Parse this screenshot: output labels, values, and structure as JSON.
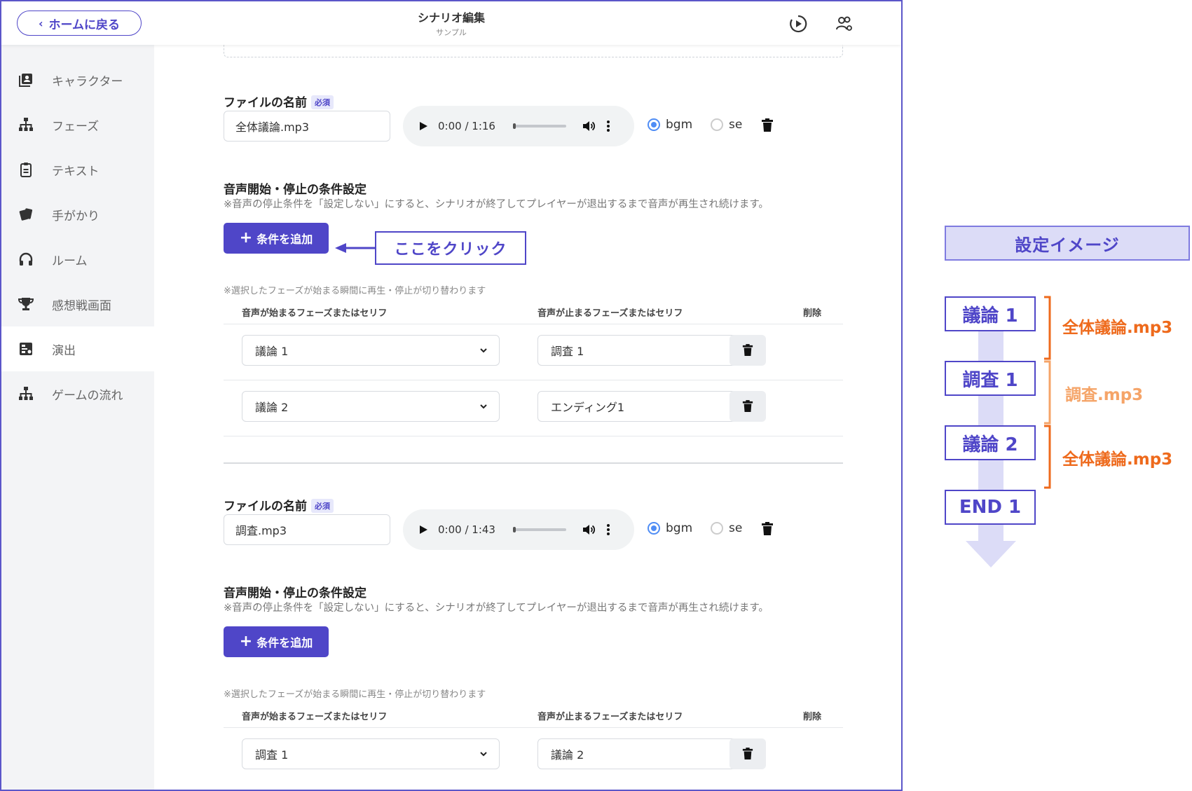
{
  "header": {
    "back_label": "ホームに戻る",
    "title": "シナリオ編集",
    "subtitle": "サンプル"
  },
  "sidebar": {
    "items": [
      {
        "label": "キャラクター",
        "icon": "character-book-icon"
      },
      {
        "label": "フェーズ",
        "icon": "hierarchy-icon"
      },
      {
        "label": "テキスト",
        "icon": "clipboard-icon"
      },
      {
        "label": "手がかり",
        "icon": "cards-icon"
      },
      {
        "label": "ルーム",
        "icon": "headphones-icon"
      },
      {
        "label": "感想戦画面",
        "icon": "trophy-icon"
      },
      {
        "label": "演出",
        "icon": "media-board-icon",
        "active": true
      },
      {
        "label": "ゲームの流れ",
        "icon": "hierarchy-icon"
      }
    ]
  },
  "files": [
    {
      "name_label": "ファイルの名前",
      "required_badge": "必須",
      "filename": "全体議論.mp3",
      "player_time": "0:00 / 1:16",
      "type_options": [
        "bgm",
        "se"
      ],
      "selected_type": "bgm",
      "cond_title": "音声開始・停止の条件設定",
      "cond_note": "※音声の停止条件を「設定しない」にすると、シナリオが終了してプレイヤーが退出するまで音声が再生され続けます。",
      "add_button": "条件を追加",
      "switch_note": "※選択したフェーズが始まる瞬間に再生・停止が切り替わります",
      "col_start": "音声が始まるフェーズまたはセリフ",
      "col_stop": "音声が止まるフェーズまたはセリフ",
      "col_delete": "削除",
      "rows": [
        {
          "start": "議論 1",
          "stop": "調査 1"
        },
        {
          "start": "議論 2",
          "stop": "エンディング1"
        }
      ]
    },
    {
      "name_label": "ファイルの名前",
      "required_badge": "必須",
      "filename": "調査.mp3",
      "player_time": "0:00 / 1:43",
      "type_options": [
        "bgm",
        "se"
      ],
      "selected_type": "bgm",
      "cond_title": "音声開始・停止の条件設定",
      "cond_note": "※音声の停止条件を「設定しない」にすると、シナリオが終了してプレイヤーが退出するまで音声が再生され続けます。",
      "add_button": "条件を追加",
      "switch_note": "※選択したフェーズが始まる瞬間に再生・停止が切り替わります",
      "col_start": "音声が始まるフェーズまたはセリフ",
      "col_stop": "音声が止まるフェーズまたはセリフ",
      "col_delete": "削除",
      "rows": [
        {
          "start": "調査 1",
          "stop": "議論 2"
        }
      ]
    }
  ],
  "callout": {
    "text": "ここをクリック"
  },
  "diagram": {
    "title": "設定イメージ",
    "stages": [
      "議論 1",
      "調査 1",
      "議論 2",
      "END 1"
    ],
    "labels": [
      {
        "text": "全体議論.mp3",
        "color": "#ee6a1c"
      },
      {
        "text": "調査.mp3",
        "color": "#f5a468"
      },
      {
        "text": "全体議論.mp3",
        "color": "#ee6a1c"
      }
    ]
  },
  "colors": {
    "accent": "#4f46c8",
    "radio": "#4f8df5",
    "sidebar_bg": "#f3f4f6"
  }
}
